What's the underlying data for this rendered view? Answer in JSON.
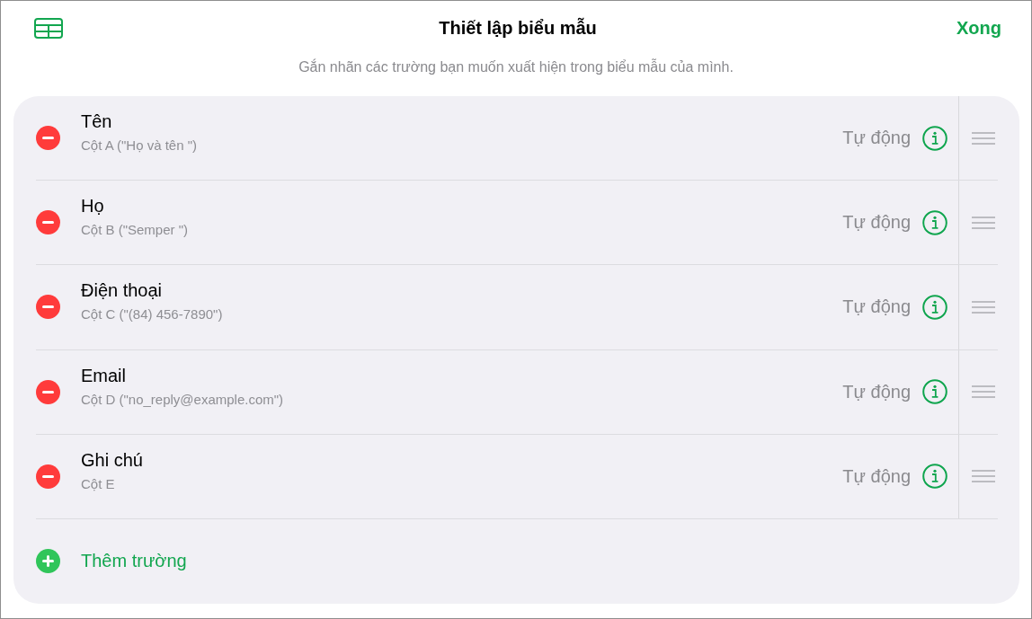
{
  "header": {
    "title": "Thiết lập biểu mẫu",
    "done_button": "Xong",
    "subtitle": "Gắn nhãn các trường bạn muốn xuất hiện trong biểu mẫu của mình."
  },
  "fields": [
    {
      "label": "Tên",
      "column": "Cột A (\"Họ và tên \")",
      "type": "Tự động"
    },
    {
      "label": "Họ",
      "column": "Cột B (\"Semper \")",
      "type": "Tự động"
    },
    {
      "label": "Điện thoại",
      "column": "Cột C (\"(84) 456-7890\")",
      "type": "Tự động"
    },
    {
      "label": "Email",
      "column": "Cột D (\"no_reply@example.com\")",
      "type": "Tự động"
    },
    {
      "label": "Ghi chú",
      "column": "Cột E",
      "type": "Tự động"
    }
  ],
  "add_field": {
    "label": "Thêm trường"
  }
}
